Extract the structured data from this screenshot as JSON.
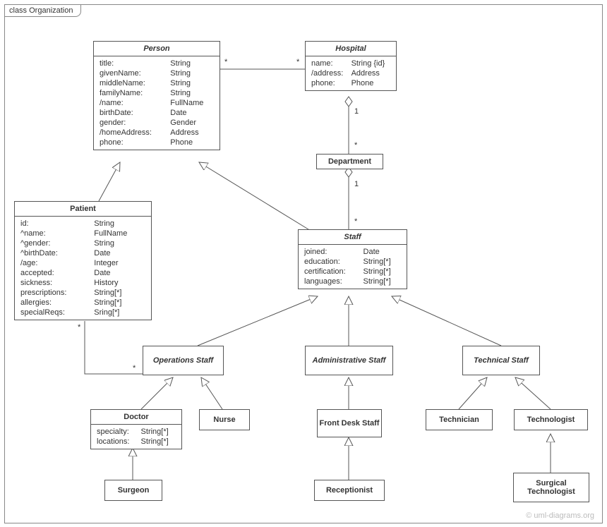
{
  "frame": {
    "title": "class Organization"
  },
  "watermark": "© uml-diagrams.org",
  "classes": {
    "person": {
      "name": "Person",
      "attrs": [
        [
          "title:",
          "String"
        ],
        [
          "givenName:",
          "String"
        ],
        [
          "middleName:",
          "String"
        ],
        [
          "familyName:",
          "String"
        ],
        [
          "/name:",
          "FullName"
        ],
        [
          "birthDate:",
          "Date"
        ],
        [
          "gender:",
          "Gender"
        ],
        [
          "/homeAddress:",
          "Address"
        ],
        [
          "phone:",
          "Phone"
        ]
      ]
    },
    "hospital": {
      "name": "Hospital",
      "attrs": [
        [
          "name:",
          "String {id}"
        ],
        [
          "/address:",
          "Address"
        ],
        [
          "phone:",
          "Phone"
        ]
      ]
    },
    "department": {
      "name": "Department",
      "attrs": []
    },
    "staff": {
      "name": "Staff",
      "attrs": [
        [
          "joined:",
          "Date"
        ],
        [
          "education:",
          "String[*]"
        ],
        [
          "certification:",
          "String[*]"
        ],
        [
          "languages:",
          "String[*]"
        ]
      ]
    },
    "patient": {
      "name": "Patient",
      "attrs": [
        [
          "id:",
          "String"
        ],
        [
          "^name:",
          "FullName"
        ],
        [
          "^gender:",
          "String"
        ],
        [
          "^birthDate:",
          "Date"
        ],
        [
          "/age:",
          "Integer"
        ],
        [
          "accepted:",
          "Date"
        ],
        [
          "sickness:",
          "History"
        ],
        [
          "prescriptions:",
          "String[*]"
        ],
        [
          "allergies:",
          "String[*]"
        ],
        [
          "specialReqs:",
          "Sring[*]"
        ]
      ]
    },
    "opstaff": {
      "name": "Operations Staff",
      "attrs": []
    },
    "adminstaff": {
      "name": "Administrative Staff",
      "attrs": []
    },
    "techstaff": {
      "name": "Technical Staff",
      "attrs": []
    },
    "doctor": {
      "name": "Doctor",
      "attrs": [
        [
          "specialty:",
          "String[*]"
        ],
        [
          "locations:",
          "String[*]"
        ]
      ]
    },
    "nurse": {
      "name": "Nurse",
      "attrs": []
    },
    "frontdesk": {
      "name": "Front Desk Staff",
      "attrs": []
    },
    "receptionist": {
      "name": "Receptionist",
      "attrs": []
    },
    "technician": {
      "name": "Technician",
      "attrs": []
    },
    "technologist": {
      "name": "Technologist",
      "attrs": []
    },
    "surgtech": {
      "name": "Surgical Technologist",
      "attrs": []
    },
    "surgeon": {
      "name": "Surgeon",
      "attrs": []
    }
  },
  "multiplicities": {
    "person_hospital_l": "*",
    "person_hospital_r": "*",
    "hosp_dept_top": "1",
    "hosp_dept_bot": "*",
    "dept_staff_top": "1",
    "dept_staff_bot": "*",
    "patient_ops_l": "*",
    "patient_ops_r": "*"
  }
}
